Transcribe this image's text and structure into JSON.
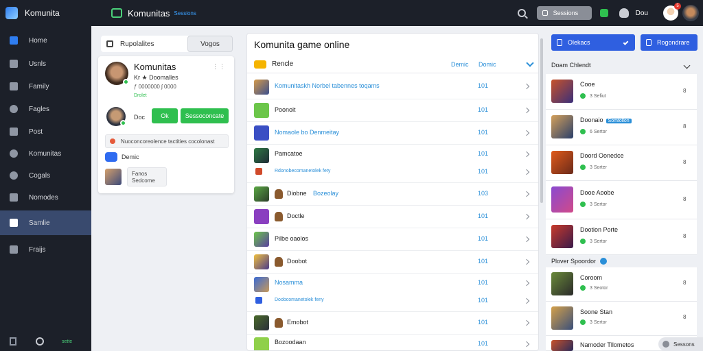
{
  "topbar": {
    "app_name": "Komunita",
    "brand": "Komunitas",
    "brand_tag": "Sessions",
    "search_label": "Sessions",
    "user_label": "Dou",
    "notification_count": "5"
  },
  "sidebar": {
    "items": [
      {
        "label": "Home",
        "icon": "home-icon"
      },
      {
        "label": "Usnls",
        "icon": "user-icon"
      },
      {
        "label": "Family",
        "icon": "family-icon"
      },
      {
        "label": "Fagles",
        "icon": "eagles-icon"
      },
      {
        "label": "Post",
        "icon": "post-icon"
      },
      {
        "label": "Komunitas",
        "icon": "community-icon"
      },
      {
        "label": "Cogals",
        "icon": "goals-icon"
      },
      {
        "label": "Nomodes",
        "icon": "modes-icon"
      },
      {
        "label": "Samlie",
        "icon": "settings-icon"
      },
      {
        "label": "Fraijs",
        "icon": "friends-icon"
      }
    ],
    "footer_text": "sette"
  },
  "left_panel": {
    "tab_label": "Rupolalites",
    "tab_button": "Vogos",
    "profile": {
      "name": "Komunitas",
      "subtitle": "Kr ★ Doomalles",
      "stat": "ƒ 0000000 ʃ 0000",
      "status": "Drolet",
      "doc_label": "Doc",
      "ok_button": "Ok",
      "action_button": "Sessoconcate",
      "note": "Nuoconcoreolence tactities cocolonast",
      "row_label": "Demic",
      "chip_title": "Fanos",
      "chip_sub": "Sedcome"
    }
  },
  "center": {
    "title": "Komunita game online",
    "header": {
      "label": "Rencle",
      "col1": "Demic",
      "col2": "Domic"
    },
    "rows": [
      {
        "label": "Komunitaskh Norbel tabennes toqams",
        "count": "101",
        "blue": true
      },
      {
        "label": "Poonoit",
        "count": "101",
        "blue": false
      },
      {
        "label": "Nomaole bo Denmeitay",
        "count": "101",
        "blue": true
      },
      {
        "label": "Pamcatoe",
        "count": "101",
        "blue": false
      },
      {
        "label": "Rdonobecomanetolek fety",
        "count": "101",
        "blue": true
      },
      {
        "label": "Diobne",
        "count": "103",
        "blue": false
      },
      {
        "label": "Bozeolay",
        "count": "",
        "blue": true
      },
      {
        "label": "Doctle",
        "count": "101",
        "blue": false
      },
      {
        "label": "Pilbe oaolos",
        "count": "101",
        "blue": false
      },
      {
        "label": "Doobot",
        "count": "101",
        "blue": false
      },
      {
        "label": "Nosamma",
        "count": "101",
        "blue": true
      },
      {
        "label": "Doobcomanetolek feny",
        "count": "101",
        "blue": true
      },
      {
        "label": "Emobot",
        "count": "101",
        "blue": false
      },
      {
        "label": "Bozoodaan",
        "count": "101",
        "blue": false
      }
    ]
  },
  "right_panel": {
    "btn1": "Olekacs",
    "btn2": "Rogondrare",
    "section1": "Doam Chlendt",
    "section2": "Plover Spoordor",
    "items": [
      {
        "name": "Cooe",
        "meta": "3 Sefiut",
        "num": "8"
      },
      {
        "name": "Doonaio",
        "tag": "Somtollon",
        "meta": "6 Sertor",
        "num": "8"
      },
      {
        "name": "Doord Oonedce",
        "meta": "3 Sorter",
        "num": "8"
      },
      {
        "name": "Dooe Aoobe",
        "meta": "3 Sertor",
        "num": "8"
      },
      {
        "name": "Dootion Porte",
        "meta": "3 Sertor",
        "num": "8"
      },
      {
        "name": "Coroom",
        "meta": "3 Seotor",
        "num": "8"
      },
      {
        "name": "Soone Stan",
        "meta": "3 Sertor",
        "num": "8"
      },
      {
        "name": "Namoder Tllometos",
        "meta": "",
        "num": ""
      }
    ],
    "floating_label": "Sessons"
  }
}
